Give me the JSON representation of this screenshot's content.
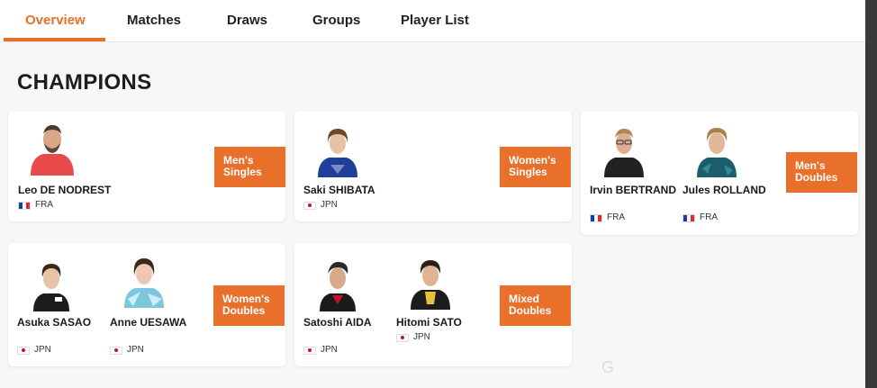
{
  "tabs": [
    "Overview",
    "Matches",
    "Draws",
    "Groups",
    "Player List"
  ],
  "heading": "CHAMPIONS",
  "events": [
    {
      "label": "Men's Singles",
      "players": [
        {
          "name": "Leo DE NODREST",
          "country": "FRA"
        }
      ]
    },
    {
      "label": "Women's Singles",
      "players": [
        {
          "name": "Saki SHIBATA",
          "country": "JPN"
        }
      ]
    },
    {
      "label": "Men's Doubles",
      "players": [
        {
          "name": "Irvin BERTRAND",
          "country": "FRA"
        },
        {
          "name": "Jules ROLLAND",
          "country": "FRA"
        }
      ]
    },
    {
      "label": "Women's Doubles",
      "players": [
        {
          "name": "Asuka SASAO",
          "country": "JPN"
        },
        {
          "name": "Anne UESAWA",
          "country": "JPN"
        }
      ]
    },
    {
      "label": "Mixed Doubles",
      "players": [
        {
          "name": "Satoshi AIDA",
          "country": "JPN"
        },
        {
          "name": "Hitomi SATO",
          "country": "JPN"
        }
      ]
    }
  ],
  "colors": {
    "accent": "#e8702a",
    "text": "#1a1a1a",
    "background": "#f7f7f7"
  },
  "watermark": "G"
}
